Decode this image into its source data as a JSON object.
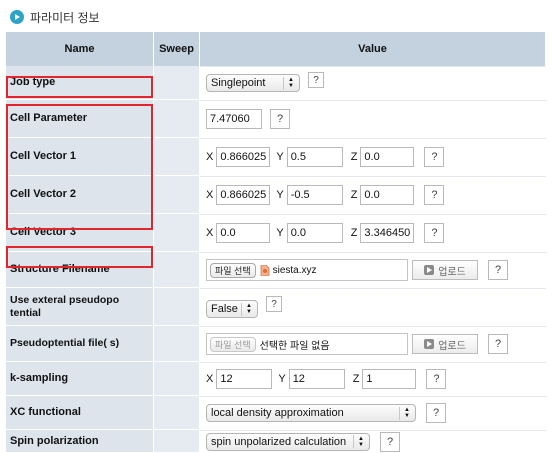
{
  "section": {
    "title": "파라미터 정보"
  },
  "table": {
    "headers": {
      "name": "Name",
      "sweep": "Sweep",
      "value": "Value"
    }
  },
  "rows": {
    "job_type": {
      "label": "Job type",
      "select": "Singlepoint",
      "help": "?"
    },
    "cell_parameter": {
      "label": "Cell Parameter",
      "value": "7.47060",
      "help": "?"
    },
    "cell_vector_1": {
      "label": "Cell Vector 1",
      "x_label": "X",
      "x": "0.866025",
      "y_label": "Y",
      "y": "0.5",
      "z_label": "Z",
      "z": "0.0",
      "help": "?"
    },
    "cell_vector_2": {
      "label": "Cell Vector 2",
      "x_label": "X",
      "x": "0.866025",
      "y_label": "Y",
      "y": "-0.5",
      "z_label": "Z",
      "z": "0.0",
      "help": "?"
    },
    "cell_vector_3": {
      "label": "Cell Vector 3",
      "x_label": "X",
      "x": "0.0",
      "y_label": "Y",
      "y": "0.0",
      "z_label": "Z",
      "z": "3.346450",
      "help": "?"
    },
    "structure_filename": {
      "label": "Structure Filename",
      "file_button": "파일 선택",
      "file_name": "siesta.xyz",
      "upload": "업로드",
      "help": "?"
    },
    "use_external": {
      "label": "Use exteral pseudopo tential",
      "select": "False",
      "help": "?"
    },
    "pseudopotential_file": {
      "label": "Pseudoptential file( s)",
      "file_button": "파일 선택",
      "file_name": "선택한 파일 없음",
      "upload": "업로드",
      "help": "?"
    },
    "k_sampling": {
      "label": "k-sampling",
      "x_label": "X",
      "x": "12",
      "y_label": "Y",
      "y": "12",
      "z_label": "Z",
      "z": "1",
      "help": "?"
    },
    "xc_functional": {
      "label": "XC functional",
      "select": "local density approximation",
      "help": "?"
    },
    "spin_polarization": {
      "label": "Spin polarization",
      "select": "spin unpolarized calculation",
      "help": "?"
    }
  },
  "colors": {
    "header_bg": "#c4d1df",
    "name_bg": "#dde4ec",
    "highlight": "#e3262b",
    "accent": "#2fa3c7"
  }
}
